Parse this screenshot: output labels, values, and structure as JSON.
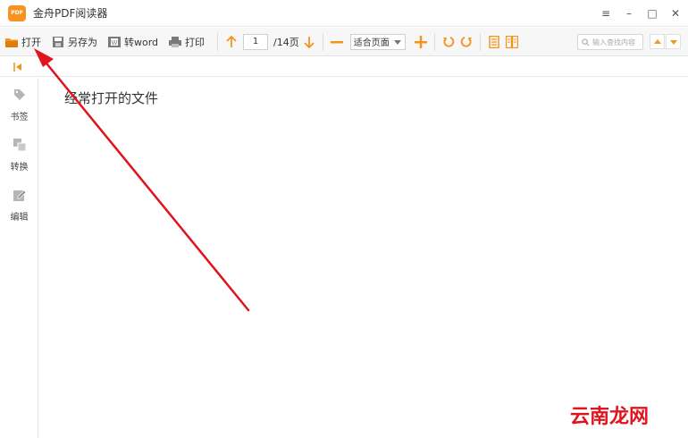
{
  "app": {
    "title": "金舟PDF阅读器",
    "logo_text": "PDF"
  },
  "toolbar": {
    "open_label": "打开",
    "save_as_label": "另存为",
    "to_word_label": "转word",
    "print_label": "打印",
    "page_current": "1",
    "page_total": "/14页",
    "zoom_value": "适合页面",
    "search_placeholder": "输入查找内容"
  },
  "sidebar": {
    "items": [
      {
        "label": "书签"
      },
      {
        "label": "转换"
      },
      {
        "label": "编辑"
      }
    ]
  },
  "main": {
    "recent_title": "经常打开的文件"
  },
  "watermark": {
    "text": "云南龙网"
  },
  "colors": {
    "accent": "#f0961e",
    "arrow": "#e0141e"
  }
}
